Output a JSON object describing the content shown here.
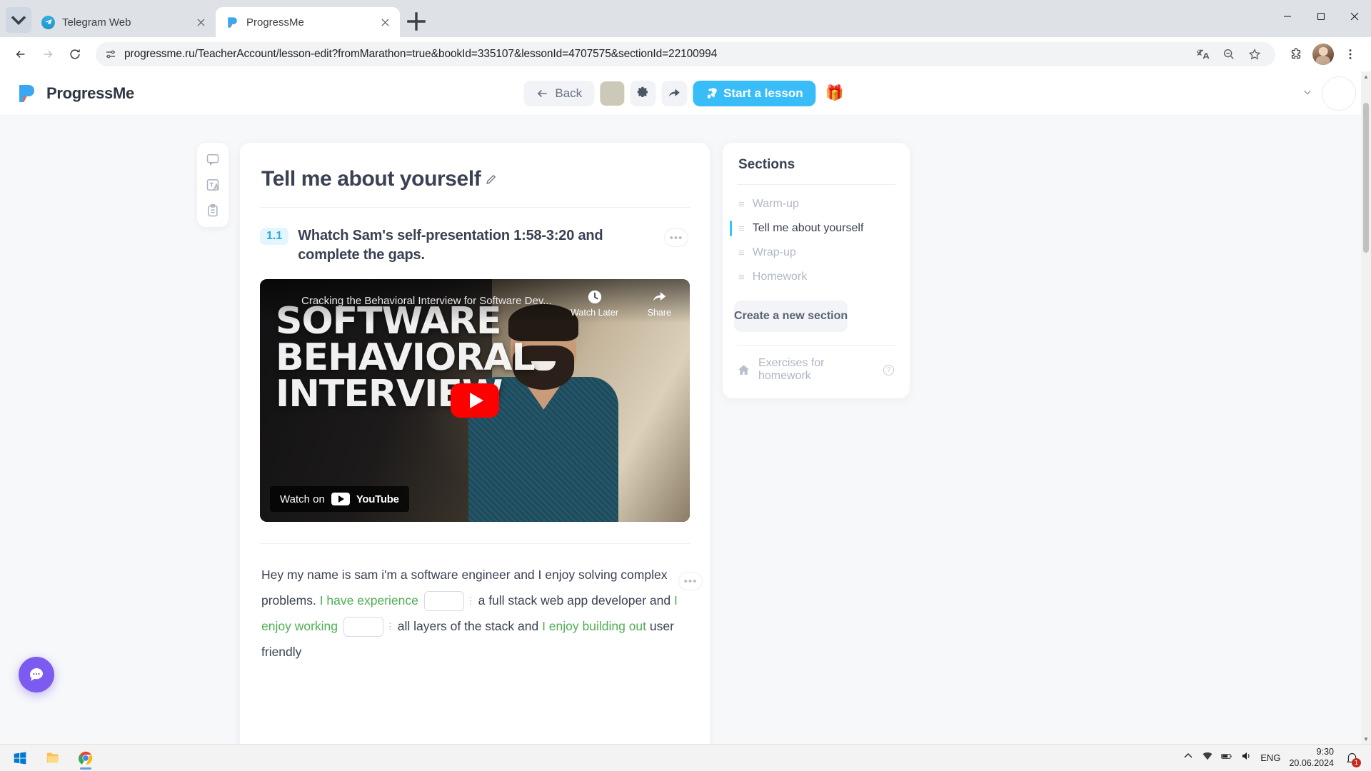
{
  "browser": {
    "tabs": [
      {
        "title": "Telegram Web",
        "favicon": "telegram-icon",
        "active": false
      },
      {
        "title": "ProgressMe",
        "favicon": "progressme-icon",
        "active": true
      }
    ],
    "newtab_label": "+",
    "url": "progressme.ru/TeacherAccount/lesson-edit?fromMarathon=true&bookId=335107&lessonId=4707575&sectionId=22100994",
    "nav": {
      "back": "back-icon",
      "forward": "forward-icon",
      "reload": "reload-icon"
    },
    "omnibox_icon": "site-settings-icon",
    "actions": [
      "translate-icon",
      "zoom-icon",
      "bookmark-star-icon",
      "extensions-icon",
      "profile-avatar",
      "chrome-menu-icon"
    ],
    "window_controls": [
      "minimize",
      "maximize",
      "close"
    ]
  },
  "app": {
    "brand": "ProgressMe",
    "toolbar": {
      "back_label": "Back",
      "thumbnail": "lesson-cover-thumbnail",
      "settings_icon": "gear-icon",
      "share_icon": "share-arrow-icon",
      "start_label": "Start a lesson",
      "start_icon": "rocket-icon",
      "gift_icon": "🎁",
      "accent_color": "#38bdf8"
    },
    "header_right": {
      "chevron": "chevron-down-icon",
      "avatar": "user-avatar"
    }
  },
  "rail": {
    "items": [
      {
        "icon": "comment-icon"
      },
      {
        "icon": "translate-card-icon"
      },
      {
        "icon": "clipboard-icon"
      }
    ]
  },
  "lesson": {
    "title": "Tell me about yourself",
    "edit_icon": "pencil-icon",
    "task": {
      "number": "1.1",
      "text": "Whatch Sam's self-presentation 1:58-3:20 and complete the gaps.",
      "menu": "•••"
    },
    "video": {
      "title": "Cracking the Behavioral Interview for Software Dev...",
      "watch_later": "Watch Later",
      "share": "Share",
      "overlay_lines": [
        "SOFTWARE",
        "BEHAVIORAL",
        "INTERVIEW"
      ],
      "watch_on": "Watch on",
      "platform": "YouTube",
      "play": "play-button"
    },
    "gap_exercise": {
      "menu": "•••",
      "parts": [
        {
          "type": "text",
          "value": "Hey my name is sam i'm a software engineer and I enjoy solving complex problems. "
        },
        {
          "type": "highlight",
          "value": "I have experience"
        },
        {
          "type": "input",
          "value": ""
        },
        {
          "type": "text",
          "value": " a full stack web app developer and "
        },
        {
          "type": "highlight",
          "value": "I enjoy working"
        },
        {
          "type": "input",
          "value": ""
        },
        {
          "type": "text",
          "value": " all layers of the stack and "
        },
        {
          "type": "highlight",
          "value": "I enjoy building out"
        },
        {
          "type": "text",
          "value": " user friendly"
        }
      ]
    }
  },
  "sections": {
    "title": "Sections",
    "items": [
      {
        "label": "Warm-up",
        "active": false
      },
      {
        "label": "Tell me about yourself",
        "active": true
      },
      {
        "label": "Wrap-up",
        "active": false
      },
      {
        "label": "Homework",
        "active": false
      }
    ],
    "create_label": "Create a new section",
    "homework": {
      "label": "Exercises for homework",
      "icon": "house-icon",
      "info": "?"
    },
    "active_color": "#36c5f0"
  },
  "chat_fab": {
    "icon": "chat-bubble-icon",
    "color": "#7c5cf0"
  },
  "taskbar": {
    "apps": [
      {
        "name": "start-button",
        "icon": "windows-logo"
      },
      {
        "name": "file-explorer",
        "icon": "folder-icon"
      },
      {
        "name": "google-chrome",
        "icon": "chrome-icon"
      }
    ],
    "tray": [
      "chevron-up-icon",
      "wifi-icon",
      "battery-icon",
      "volume-icon"
    ],
    "language": "ENG",
    "time": "9:30",
    "date": "20.06.2024",
    "notification_count": "1"
  }
}
